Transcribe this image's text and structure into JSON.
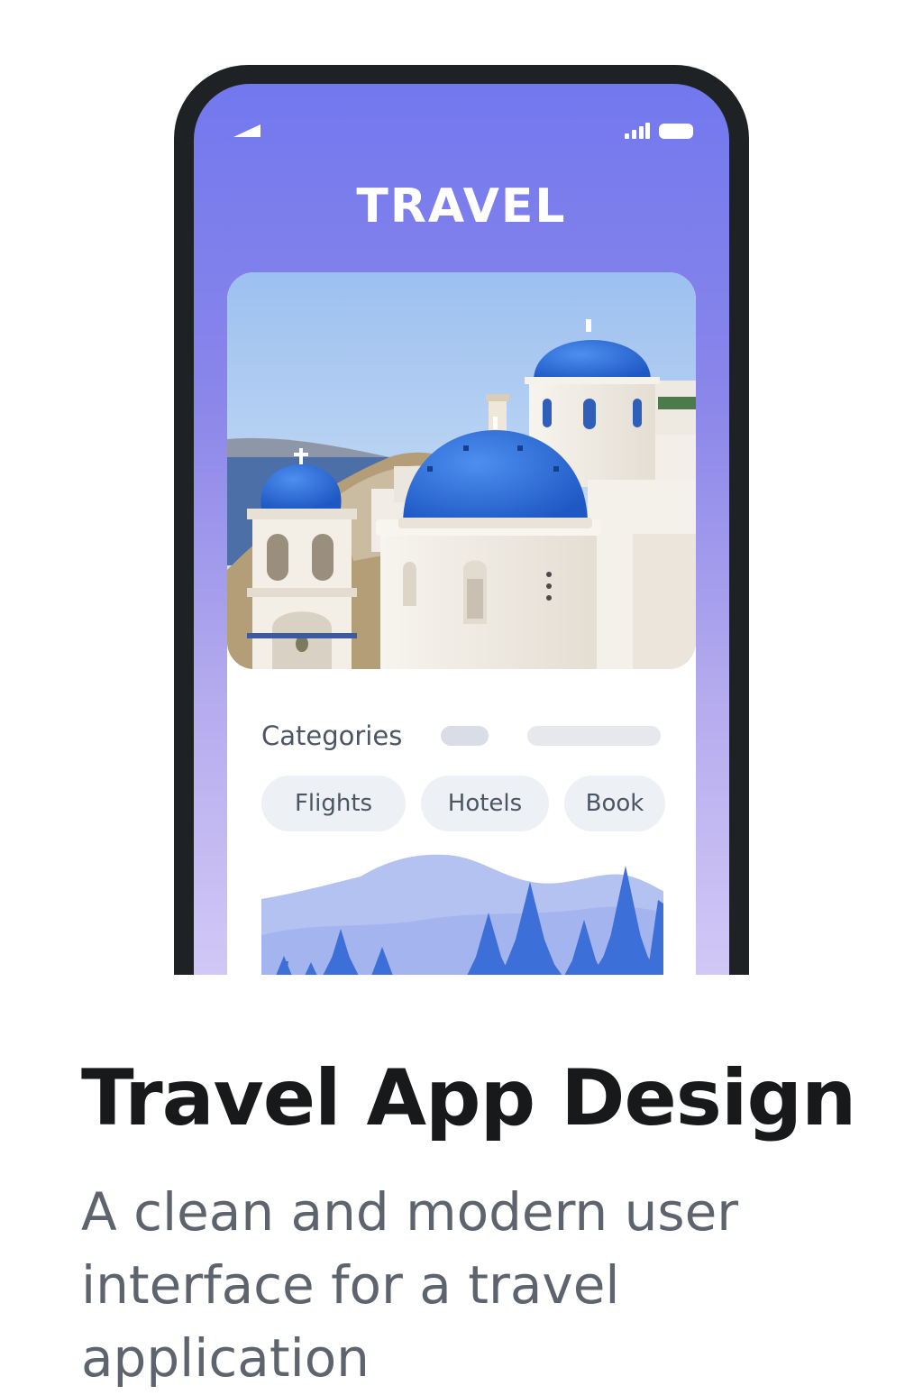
{
  "app": {
    "title": "TRAVEL",
    "status_bar": {
      "left_icon": "signal-wedge-icon",
      "right_icons": [
        "cellular-signal-icon",
        "battery-icon"
      ]
    }
  },
  "hero": {
    "image": "santorini-blue-domes-photo"
  },
  "categories": {
    "label": "Categories",
    "chips": [
      "Flights",
      "Hotels",
      "Book"
    ]
  },
  "illustration": {
    "image": "mountains-and-pine-trees-illustration"
  },
  "caption": {
    "headline": "Travel App Design",
    "subtitle": "A clean and modern user interface for a travel application"
  },
  "colors": {
    "header_gradient_top": "#7278ee",
    "header_gradient_bottom": "#d2c8f6",
    "dome_blue": "#2f6fd6",
    "tree_blue": "#3d6fd8",
    "chip_background": "#edf0f5",
    "headline_text": "#17191b",
    "subtitle_text": "#5e646d"
  }
}
